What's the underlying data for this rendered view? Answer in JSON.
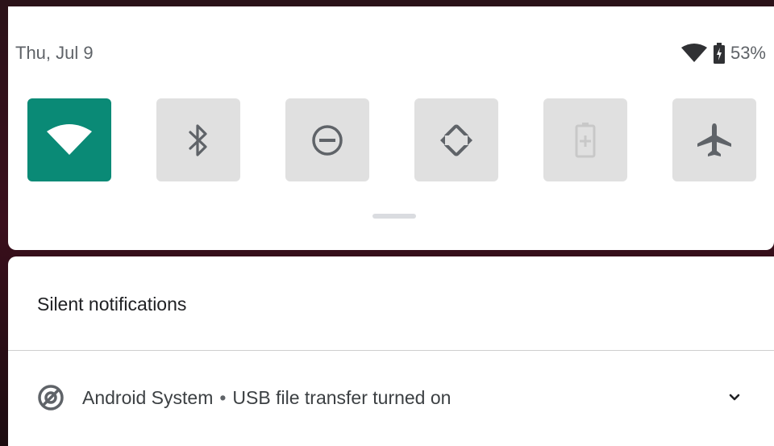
{
  "status": {
    "date": "Thu, Jul 9",
    "battery_percent": "53%",
    "icons": [
      "wifi-icon",
      "battery-icon"
    ]
  },
  "quick_tiles": [
    {
      "name": "wifi",
      "icon": "wifi-icon",
      "active": true
    },
    {
      "name": "bluetooth",
      "icon": "bluetooth-icon",
      "active": false
    },
    {
      "name": "do-not-disturb",
      "icon": "do-not-disturb-icon",
      "active": false
    },
    {
      "name": "auto-rotate",
      "icon": "auto-rotate-icon",
      "active": false
    },
    {
      "name": "battery-saver",
      "icon": "battery-saver-icon",
      "active": false
    },
    {
      "name": "airplane-mode",
      "icon": "airplane-icon",
      "active": false
    }
  ],
  "colors": {
    "active_tile": "#0a8a76",
    "inactive_tile": "#e0e0e0"
  },
  "notifications": {
    "section_title": "Silent notifications",
    "items": [
      {
        "app": "Android System",
        "separator": "•",
        "message": "USB file transfer turned on",
        "icon": "android-system-icon",
        "expand_icon": "chevron-down-icon"
      }
    ]
  }
}
